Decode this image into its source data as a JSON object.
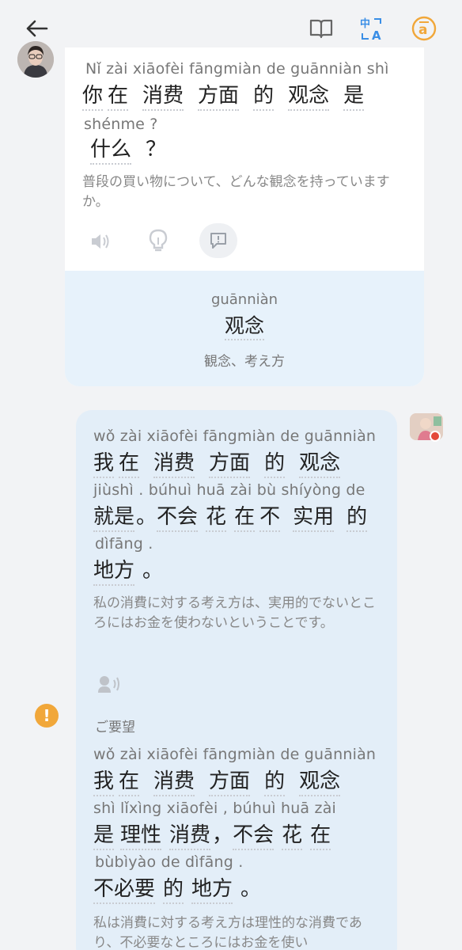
{
  "topbar": {
    "back_icon": "arrow-left-icon",
    "book_icon": "book-icon",
    "translate_icon": "translate-icon",
    "furigana_icon": "furigana-toggle-icon",
    "accent": "#f1a73a",
    "translate_color": "#3a8ee6"
  },
  "ai_message": {
    "pinyin1": "Nǐ  zài  xiāofèi  fāngmiàn  de  guānniàn  shì",
    "hanzi1": [
      "你",
      "在",
      "消费",
      "方面",
      "的",
      "观念",
      "是"
    ],
    "pinyin2": "shénme   ?",
    "hanzi2": [
      "什么",
      "？"
    ],
    "translation": "普段の買い物について、どんな観念を持っていますか。",
    "speaker_icon": "speaker-icon",
    "hint_icon": "lightbulb-icon",
    "explain_icon": "explain-icon"
  },
  "word_card": {
    "pinyin": "guānniàn",
    "hanzi": "观念",
    "meaning": "観念、考え方"
  },
  "user_message": {
    "pinyin1": "wǒ  zài  xiāofèi  fāngmiàn  de  guānniàn",
    "hanzi1": [
      "我",
      "在",
      "消费",
      "方面",
      "的",
      "观念"
    ],
    "pinyin2": "jiùshì   .   búhuì  huā  zài  bù  shíyòng  de",
    "hanzi2": [
      "就是",
      "。",
      "不会",
      "花",
      "在",
      "不",
      "实用",
      "的"
    ],
    "pinyin3": "dìfāng   .",
    "hanzi3": [
      "地方",
      "。"
    ],
    "translation": "私の消費に対する考え方は、実用的でないところにはお金を使わないということです。",
    "voice_icon": "voice-icon"
  },
  "suggestion": {
    "warn_symbol": "!",
    "label": "ご要望",
    "pinyin1": "wǒ  zài  xiāofèi  fāngmiàn  de  guānniàn",
    "hanzi1": [
      "我",
      "在",
      "消费",
      "方面",
      "的",
      "观念"
    ],
    "pinyin2": "shì  lǐxìng  xiāofèi  ,  búhuì  huā  zài",
    "hanzi2": [
      "是",
      "理性",
      "消费",
      "，",
      "不会",
      "花",
      "在"
    ],
    "pinyin3": "bùbìyào   de  dìfāng   .",
    "hanzi3": [
      "不必要",
      "的",
      "地方",
      "。"
    ],
    "translation": "私は消費に対する考え方は理性的な消費であり、不必要なところにはお金を使い"
  }
}
